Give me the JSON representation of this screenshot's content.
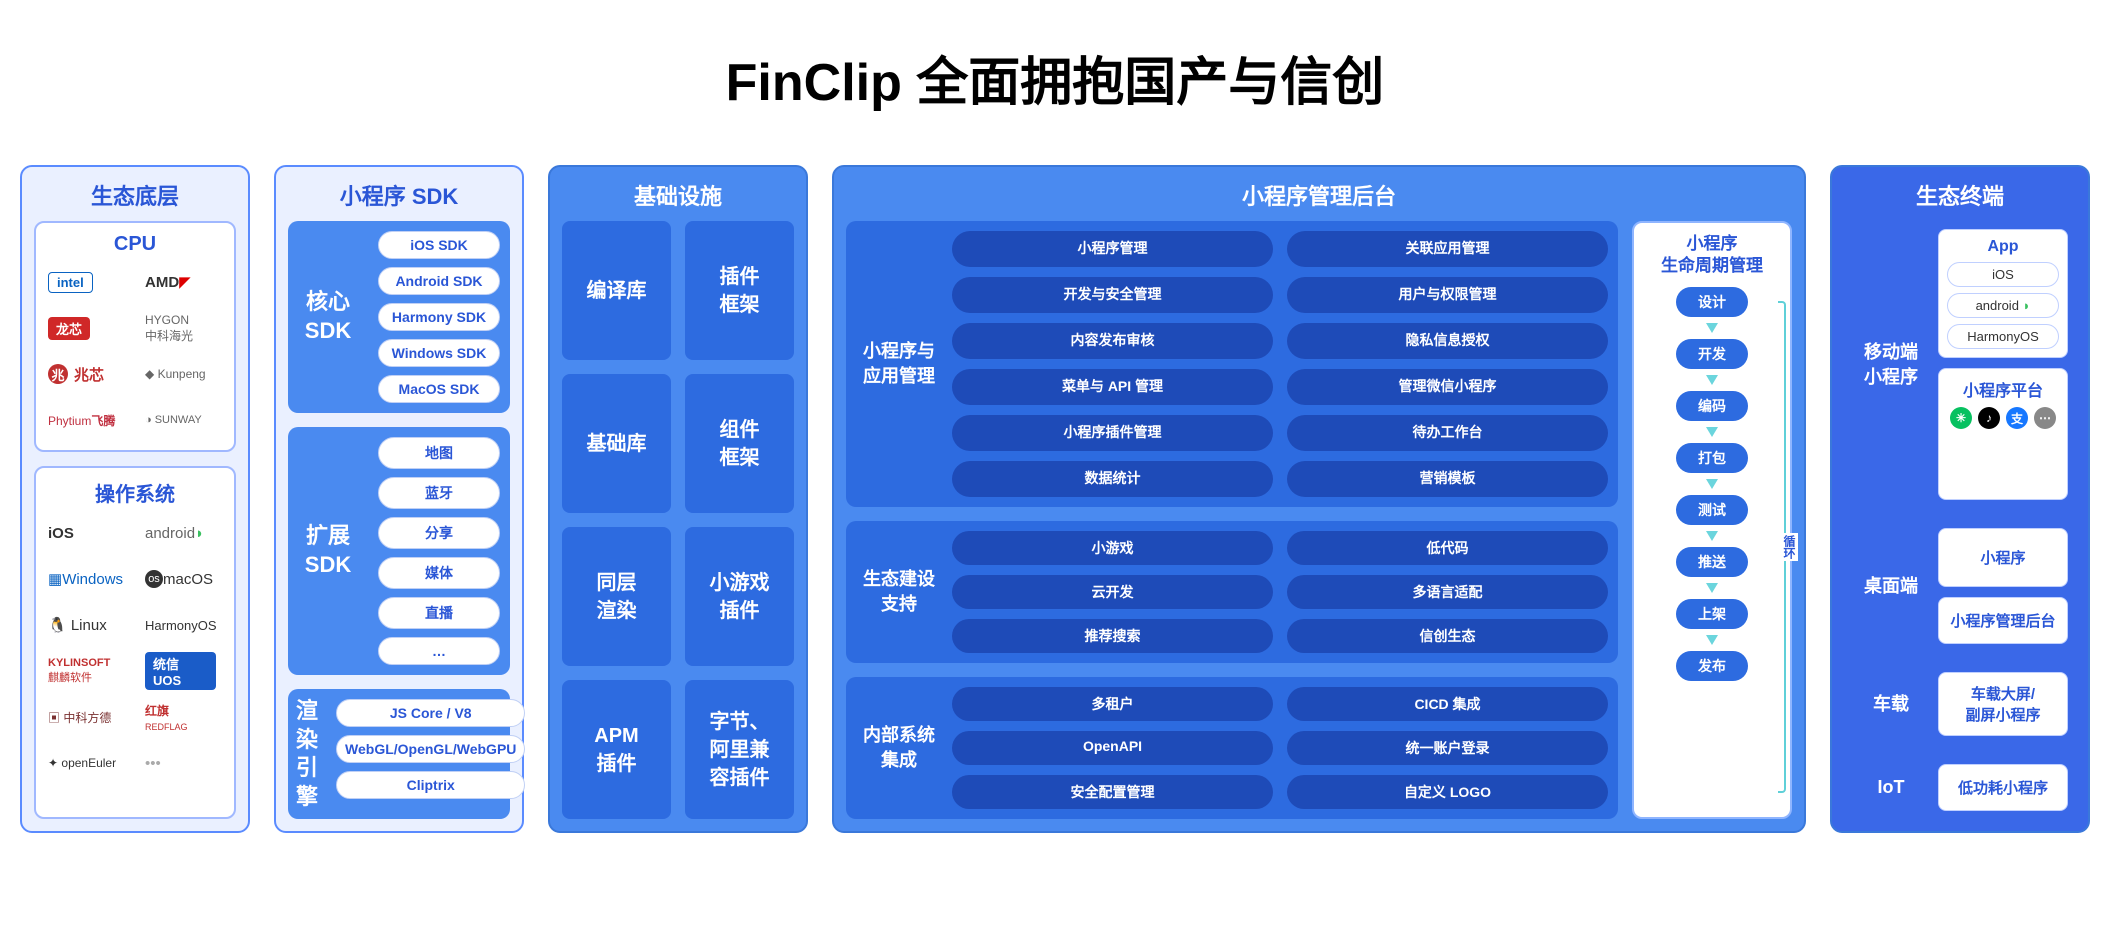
{
  "title": "FinClip 全面拥抱国产与信创",
  "col1": {
    "title": "生态底层",
    "cpu": {
      "title": "CPU",
      "logos": [
        "intel",
        "AMD",
        "龙芯",
        "HYGON 中科海光",
        "兆芯",
        "Kunpeng",
        "Phytium 飞腾",
        "SUNWAY"
      ]
    },
    "os": {
      "title": "操作系统",
      "logos": [
        "iOS",
        "android",
        "Windows",
        "macOS",
        "Linux",
        "HarmonyOS",
        "KYLINSOFT 麒麟软件",
        "统信 UOS",
        "中科方德",
        "红旗 REDFLAG",
        "openEuler",
        "…"
      ]
    }
  },
  "col2": {
    "title": "小程序 SDK",
    "core": {
      "label": "核心\nSDK",
      "items": [
        "iOS SDK",
        "Android SDK",
        "Harmony SDK",
        "Windows SDK",
        "MacOS SDK"
      ]
    },
    "ext": {
      "label": "扩展\nSDK",
      "items": [
        "地图",
        "蓝牙",
        "分享",
        "媒体",
        "直播",
        "…"
      ]
    },
    "render": {
      "label": "渲染\n引擎",
      "items": [
        "JS Core  /  V8",
        "WebGL/OpenGL/WebGPU",
        "Cliptrix"
      ]
    }
  },
  "col3": {
    "title": "基础设施",
    "tiles": [
      "编译库",
      "插件\n框架",
      "基础库",
      "组件\n框架",
      "同层\n渲染",
      "小游戏\n插件",
      "APM\n插件",
      "字节、\n阿里兼\n容插件"
    ]
  },
  "col4": {
    "title": "小程序管理后台",
    "blocks": [
      {
        "label": "小程序与\n应用管理",
        "items": [
          "小程序管理",
          "关联应用管理",
          "开发与安全管理",
          "用户与权限管理",
          "内容发布审核",
          "隐私信息授权",
          "菜单与 API 管理",
          "管理微信小程序",
          "小程序插件管理",
          "待办工作台",
          "数据统计",
          "营销模板"
        ]
      },
      {
        "label": "生态建设\n支持",
        "items": [
          "小游戏",
          "低代码",
          "云开发",
          "多语言适配",
          "推荐搜索",
          "信创生态"
        ]
      },
      {
        "label": "内部系统\n集成",
        "items": [
          "多租户",
          "CICD 集成",
          "OpenAPI",
          "统一账户登录",
          "安全配置管理",
          "自定义 LOGO"
        ]
      }
    ],
    "lifecycle": {
      "title": "小程序\n生命周期管理",
      "steps": [
        "设计",
        "开发",
        "编码",
        "打包",
        "测试",
        "推送",
        "上架",
        "发布"
      ],
      "loop": "循环"
    }
  },
  "col5": {
    "title": "生态终端",
    "mobile": {
      "label": "移动端\n小程序",
      "app": {
        "title": "App",
        "items": [
          "iOS",
          "android",
          "HarmonyOS"
        ]
      },
      "platform": {
        "title": "小程序平台"
      }
    },
    "desktop": {
      "label": "桌面端",
      "items": [
        "小程序",
        "小程序管理后台"
      ]
    },
    "car": {
      "label": "车载",
      "items": [
        "车载大屏/\n副屏小程序"
      ]
    },
    "iot": {
      "label": "IoT",
      "items": [
        "低功耗小程序"
      ]
    }
  }
}
